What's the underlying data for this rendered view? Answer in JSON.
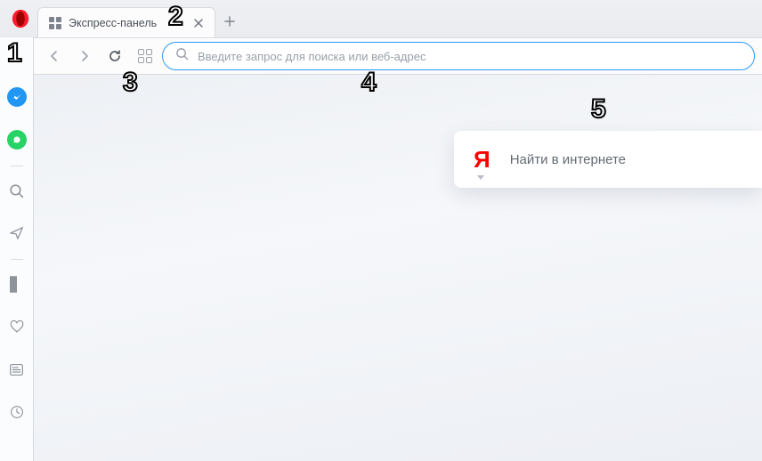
{
  "tab": {
    "title": "Экспресс-панель"
  },
  "omnibox": {
    "placeholder": "Введите запрос для поиска или веб-адрес"
  },
  "yandex": {
    "logo_letter": "Я",
    "placeholder": "Найти в интернете"
  },
  "callouts": {
    "c1": "1",
    "c2": "2",
    "c3": "3",
    "c4": "4",
    "c5": "5"
  }
}
